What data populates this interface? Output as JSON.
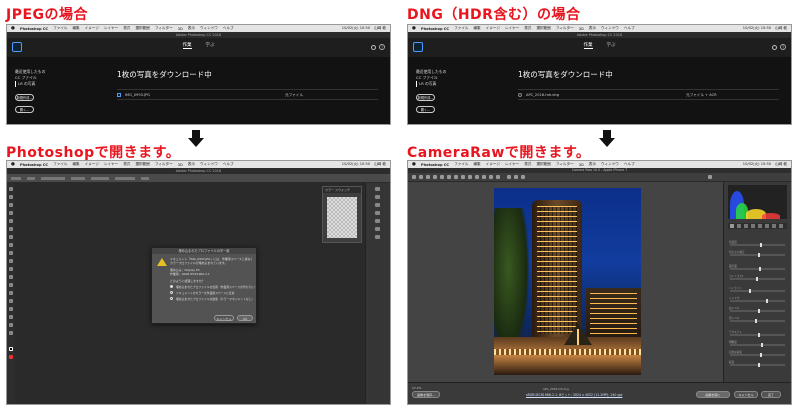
{
  "headings": {
    "jpeg": "JPEGの場合",
    "dng": "DNG（HDR含む）の場合",
    "photoshop": "Photoshopで開きます。",
    "cameraraw": "CameraRawで開きます。"
  },
  "colors": {
    "heading": "#e8141e",
    "accent": "#4a9eff"
  },
  "menubar": {
    "apple": "",
    "items": [
      "Photoshop CC",
      "ファイル",
      "編集",
      "イメージ",
      "レイヤー",
      "書式",
      "選択範囲",
      "フィルター",
      "3D",
      "表示",
      "ウィンドウ",
      "ヘルプ"
    ],
    "clock": "10/02(火) 10:50",
    "user": "山崎 敦"
  },
  "lightroom": {
    "title": "Adobe Photoshop CC 2018",
    "tabs": [
      "作業",
      "学ぶ"
    ],
    "sidebar": [
      "最近使用したもの",
      "CC ファイル",
      "LR の写真"
    ],
    "buttons": [
      "新規作成...",
      "開く..."
    ],
    "jpeg": {
      "heading": "1枚の写真をダウンロード中",
      "filename": "IMG_0993.JPG",
      "status": "元ファイル"
    },
    "dng": {
      "heading": "1枚の写真をダウンロード中",
      "filename": "APC_2018-hdr.dng",
      "status": "元ファイル + ACR"
    }
  },
  "photoshop": {
    "title": "Adobe Photoshop CC 2018",
    "panel_tabs": [
      "カラー",
      "スウォッチ"
    ],
    "dialog": {
      "title": "埋め込まれたプロファイルの不一致",
      "lines": [
        "ドキュメント「IMG_0993.JPG」には、作業用スペースと異なる",
        "カラープロファイルが埋め込まれています。"
      ],
      "embedded": "埋め込み：Display P3",
      "working": "作業用：sRGB IEC61966-2.1",
      "question": "どのように処理しますか？",
      "options": [
        "埋め込まれたプロファイルを使用（作業用スペースの代わりに）",
        "ドキュメントのカラーを作業用スペースに変換",
        "埋め込まれたプロファイルを破棄（カラーマネジメントなし）"
      ],
      "cancel": "キャンセル",
      "ok": "OK"
    }
  },
  "cameraraw": {
    "title": "Camera Raw 10.0 - Apple iPhone 7",
    "zoom": "17.2%",
    "filename": "APC_2018-hdr.dng",
    "workflow_link": "sRGB IEC61966-2.1; 8ビット; 3024 x 4032 (12.2MP); 240 ppi",
    "buttons": [
      "画像を保存...",
      "画像を開く",
      "キャンセル",
      "完了"
    ],
    "sliders": [
      "色温度",
      "色かぶり補正",
      "露光量",
      "コントラスト",
      "ハイライト",
      "シャドウ",
      "白レベル",
      "黒レベル",
      "テクスチャ",
      "明瞭度",
      "自然な彩度",
      "彩度"
    ]
  }
}
